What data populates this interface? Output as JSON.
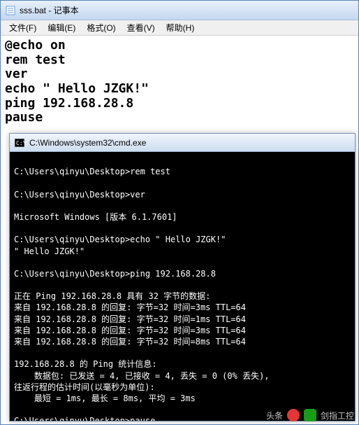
{
  "notepad": {
    "title": "sss.bat - 记事本",
    "menu": {
      "file": "文件(F)",
      "edit": "编辑(E)",
      "format": "格式(O)",
      "view": "查看(V)",
      "help": "帮助(H)"
    },
    "content": "@echo on\nrem test\nver\necho \" Hello JZGK!\"\nping 192.168.28.8\npause"
  },
  "console": {
    "title": "C:\\Windows\\system32\\cmd.exe",
    "output": "\nC:\\Users\\qinyu\\Desktop>rem test\n\nC:\\Users\\qinyu\\Desktop>ver\n\nMicrosoft Windows [版本 6.1.7601]\n\nC:\\Users\\qinyu\\Desktop>echo \" Hello JZGK!\"\n\" Hello JZGK!\"\n\nC:\\Users\\qinyu\\Desktop>ping 192.168.28.8\n\n正在 Ping 192.168.28.8 具有 32 字节的数据:\n来自 192.168.28.8 的回复: 字节=32 时间=3ms TTL=64\n来自 192.168.28.8 的回复: 字节=32 时间=1ms TTL=64\n来自 192.168.28.8 的回复: 字节=32 时间=3ms TTL=64\n来自 192.168.28.8 的回复: 字节=32 时间=8ms TTL=64\n\n192.168.28.8 的 Ping 统计信息:\n    数据包: 已发送 = 4, 已接收 = 4, 丢失 = 0 (0% 丢失),\n往返行程的估计时间(以毫秒为单位):\n    最短 = 1ms, 最长 = 8ms, 平均 = 3ms\n\nC:\\Users\\qinyu\\Desktop>pause\n请按任意键继续. . ."
  },
  "watermark": {
    "text1": "头条",
    "text2": "剑指工控"
  }
}
